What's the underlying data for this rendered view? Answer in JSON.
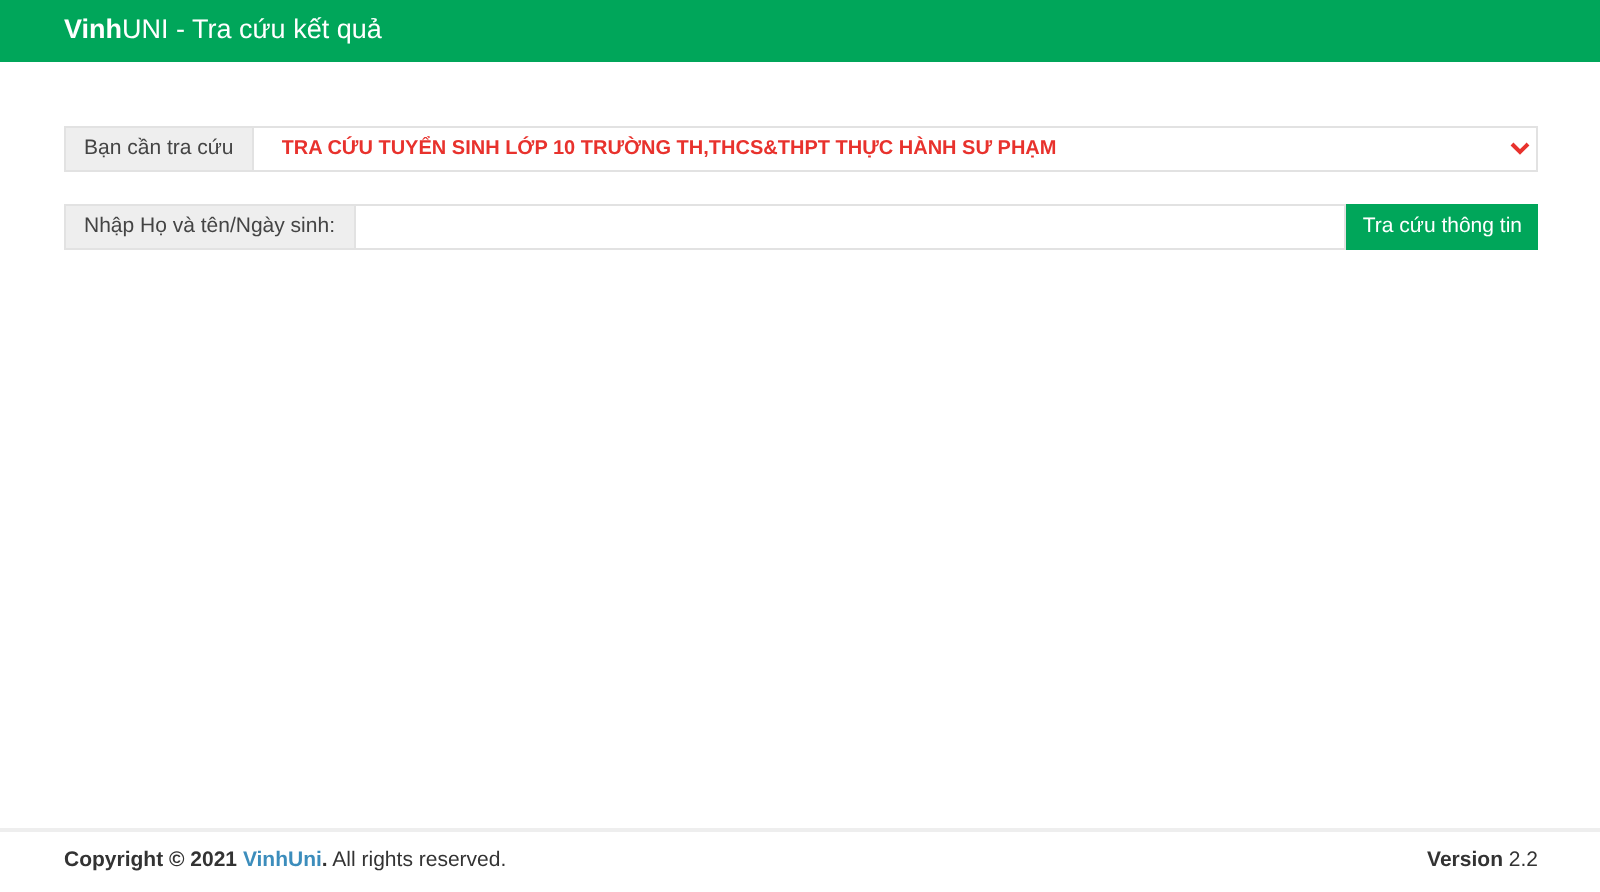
{
  "header": {
    "title": "**Vinh**UNI - Tra cứu kết quả"
  },
  "lookup": {
    "label": "Bạn cần tra cứu",
    "selected_option": "TRA CỨU TUYỂN SINH LỚP 10 TRƯỜNG TH,THCS&THPT THỰC HÀNH SƯ PHẠM"
  },
  "search": {
    "label": "Nhập Họ và tên/Ngày sinh:",
    "button": "Tra cứu thông tin"
  },
  "footer": {
    "copyright_prefix": "**Copyright © 2021** ",
    "link": "VinhUni",
    "copyright_suffix": "**.** All rights reserved.",
    "version": "**Version** 2.2"
  }
}
